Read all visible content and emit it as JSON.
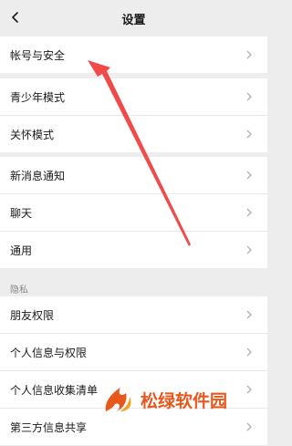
{
  "header": {
    "title": "设置",
    "back_icon": "chevron-left-icon"
  },
  "groups": [
    {
      "items": [
        {
          "label": "帐号与安全"
        }
      ]
    },
    {
      "items": [
        {
          "label": "青少年模式"
        },
        {
          "label": "关怀模式"
        }
      ]
    },
    {
      "items": [
        {
          "label": "新消息通知"
        },
        {
          "label": "聊天"
        },
        {
          "label": "通用"
        }
      ]
    }
  ],
  "privacy": {
    "section_label": "隐私",
    "items": [
      {
        "label": "朋友权限"
      },
      {
        "label": "个人信息与权限"
      },
      {
        "label": "个人信息收集清单"
      },
      {
        "label": "第三方信息共享"
      }
    ]
  },
  "overlay": {
    "arrow_color": "#f04a4a"
  },
  "watermark": {
    "text": "松绿软件园",
    "color": "#e8571c"
  }
}
